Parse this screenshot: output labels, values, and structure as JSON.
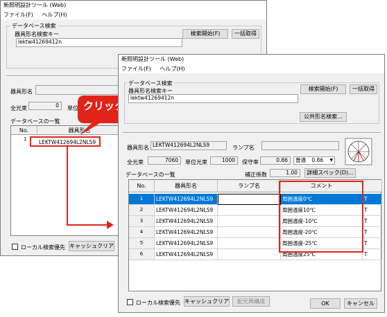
{
  "back_window": {
    "title": "新照明設計ツール (Web)",
    "menu": [
      "ファイル(F)",
      "ヘルプ(H)"
    ],
    "db_search_label": "データベース検索",
    "fixture_key_label": "器具形名検索キー",
    "fixture_key_value": "lektw41269412n",
    "search_button": "検索開始(F)",
    "batch_button": "一括取得",
    "fixture_name_label": "器具形名",
    "total_flux_label": "全光束",
    "total_flux_value": "0",
    "unit_label": "単位",
    "list_label": "データベースの一覧",
    "col_no": "No.",
    "col_name": "器具形名",
    "row_no": "1",
    "row_name": "LEKTW412694L2NLS9",
    "local_priority": "ローカル検索優先",
    "cache_clear": "キャッシュクリア"
  },
  "front_window": {
    "title": "新照明設計ツール (Web)",
    "menu": [
      "ファイル(F)",
      "ヘルプ(H)"
    ],
    "db_search_label": "データベース検索",
    "fixture_key_label": "器具形名検索キー",
    "fixture_key_value": "lektw41269412n",
    "search_button": "検索開始(F)",
    "batch_button": "一括取得",
    "public_search_button": "公共形名検索...",
    "fixture_name_label": "器具形名",
    "fixture_name_value": "LEKTW412694L2NLS9",
    "lamp_name_label": "ランプ名",
    "lamp_name_value": "",
    "total_flux_label": "全光束",
    "total_flux_value": "7060",
    "unit_flux_label": "単位光束",
    "unit_flux_value": "1000",
    "maintenance_label": "保守率",
    "maintenance_value": "0.86",
    "maintenance_mode": "普通",
    "maintenance_mode_value": "0.86",
    "list_label": "データベースの一覧",
    "correction_label": "補正係数",
    "correction_value": "1.00",
    "detail_spec_button": "詳細スペック(D)...",
    "columns": [
      "No.",
      "器具形名",
      "ランプ名",
      "コメント"
    ],
    "rows": [
      {
        "no": "1",
        "name": "LEKTW412694L2NLS9",
        "lamp": "",
        "comment": "周囲温度0℃",
        "extra": "T"
      },
      {
        "no": "2",
        "name": "LEKTW412694L2NLS9",
        "lamp": "",
        "comment": "周囲温度10℃",
        "extra": "T"
      },
      {
        "no": "3",
        "name": "LEKTW412694L2NLS9",
        "lamp": "",
        "comment": "周囲温度-10℃",
        "extra": "T"
      },
      {
        "no": "4",
        "name": "LEKTW412694L2NLS9",
        "lamp": "",
        "comment": "周囲温度-20℃",
        "extra": "T"
      },
      {
        "no": "5",
        "name": "LEKTW412694L2NLS9",
        "lamp": "",
        "comment": "周囲温度-25℃",
        "extra": "T"
      },
      {
        "no": "6",
        "name": "LEKTW412694L2NLS9",
        "lamp": "",
        "comment": "周囲温度25℃",
        "extra": "T"
      }
    ],
    "local_priority": "ローカル検索優先",
    "cache_clear": "キャッシュクリア",
    "light_distribution_button": "配光再構成",
    "ok_button": "OK",
    "cancel_button": "キャンセル"
  },
  "callout": {
    "text": "クリック",
    "color": "#e2231a"
  },
  "colors": {
    "highlight": "#e2231a",
    "selection": "#0078d7"
  }
}
